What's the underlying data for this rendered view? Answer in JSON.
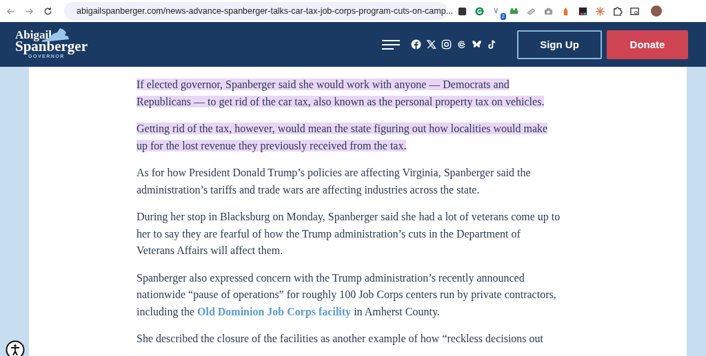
{
  "browser": {
    "url": "abigailspanberger.com/news-advance-spanberger-talks-car-tax-job-corps-program-cuts-on-camp...",
    "extension_badge": "2"
  },
  "header": {
    "logo": {
      "line1": "Abigail",
      "line2": "Spanberger",
      "tagline": "GOVERNOR"
    },
    "buttons": [
      {
        "label": "Sign Up",
        "kind": "outline"
      },
      {
        "label": "Donate",
        "kind": "filled"
      }
    ]
  },
  "article": {
    "paragraphs": [
      {
        "text": "If elected governor, Spanberger said she would work with anyone — Democrats and Republicans — to get rid of the car tax, also known as the personal property tax on vehicles.",
        "highlighted": true
      },
      {
        "text": "Getting rid of the tax, however, would mean the state figuring out how localities would make up for the lost revenue they previously received from the tax.",
        "highlighted": true
      },
      {
        "text": "As for how President Donald Trump’s policies are affecting Virginia, Spanberger said the administration’s tariffs and trade wars are affecting industries across the state.",
        "highlighted": false
      },
      {
        "text": "During her stop in Blacksburg on Monday, Spanberger said she had a lot of veterans come up to her to say they are fearful of how the Trump administration’s cuts in the Department of Veterans Affairs will affect them.",
        "highlighted": false
      },
      {
        "text": "Spanberger also expressed concern with the Trump administration’s recently announced nationwide “pause of operations” for roughly 100 Job Corps centers run by private contractors, including the",
        "link": "Old Dominion Job Corps facility",
        "after": "in Amherst County.",
        "highlighted": false
      },
      {
        "text": "She described the closure of the facilities as another example of how “reckless decisions out",
        "highlighted": false
      }
    ]
  }
}
